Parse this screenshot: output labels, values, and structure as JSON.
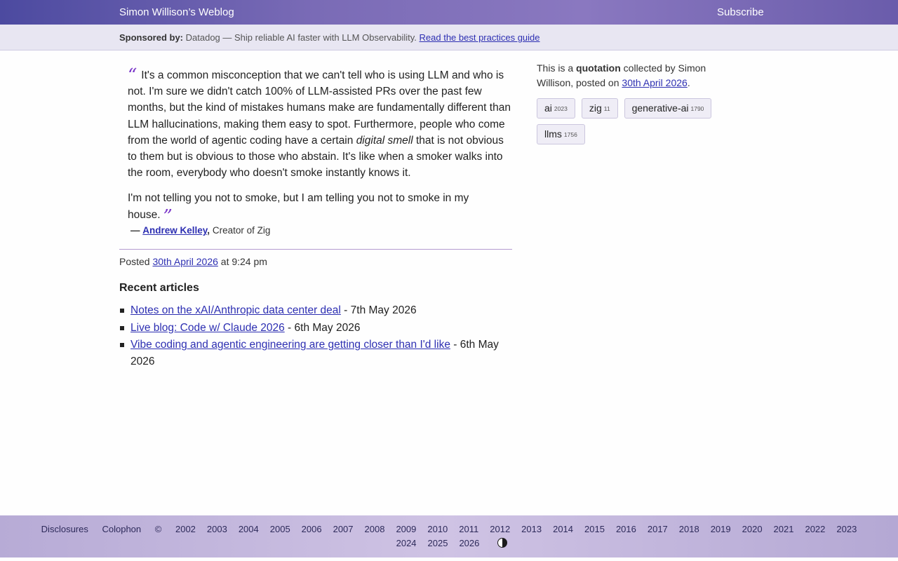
{
  "header": {
    "site_title": "Simon Willison’s Weblog",
    "subscribe_label": "Subscribe"
  },
  "sponsor": {
    "label": "Sponsored by:",
    "text": "Datadog — Ship reliable AI faster with LLM Observability.",
    "link_text": "Read the best practices guide"
  },
  "quote": {
    "p1_before": "It's a common misconception that we can't tell who is using LLM and who is not. I'm sure we didn't catch 100% of LLM-assisted PRs over the past few months, but the kind of mistakes humans make are fundamentally different than LLM hallucinations, making them easy to spot. Furthermore, people who come from the world of agentic coding have a certain ",
    "p1_em": "digital smell",
    "p1_after": " that is not obvious to them but is obvious to those who abstain. It's like when a smoker walks into the room, everybody who doesn't smoke instantly knows it.",
    "p2": "I'm not telling you not to smoke, but I am telling you not to smoke in my house.",
    "open_mark": "“",
    "close_mark": "”"
  },
  "citation": {
    "dash": "—",
    "author": "Andrew Kelley",
    "comma": ",",
    "role": "Creator of Zig"
  },
  "posted": {
    "prefix": "Posted",
    "date": "30th April 2026",
    "time": "at 9:24 pm"
  },
  "recent": {
    "title": "Recent articles",
    "items": [
      {
        "title": "Notes on the xAI/Anthropic data center deal",
        "date": "- 7th May 2026"
      },
      {
        "title": "Live blog: Code w/ Claude 2026",
        "date": "- 6th May 2026"
      },
      {
        "title": "Vibe coding and agentic engineering are getting closer than I'd like",
        "date": "- 6th May 2026"
      }
    ]
  },
  "sidebar": {
    "info_prefix": "This is a",
    "info_bold": "quotation",
    "info_mid": "collected by Simon Willison, posted on",
    "info_date": "30th April 2026",
    "info_end": ".",
    "tags": [
      {
        "name": "ai",
        "count": "2023"
      },
      {
        "name": "zig",
        "count": "11"
      },
      {
        "name": "generative-ai",
        "count": "1790"
      },
      {
        "name": "llms",
        "count": "1756"
      }
    ]
  },
  "footer": {
    "disclosures": "Disclosures",
    "colophon": "Colophon",
    "copyright": "©",
    "years_line1": [
      "2002",
      "2003",
      "2004",
      "2005",
      "2006",
      "2007",
      "2008",
      "2009",
      "2010",
      "2011",
      "2012",
      "2013",
      "2014",
      "2015",
      "2016",
      "2017",
      "2018",
      "2019",
      "2020",
      "2021",
      "2022",
      "2023"
    ],
    "years_line2": [
      "2024",
      "2025",
      "2026"
    ],
    "contrast_icon": "contrast-icon"
  }
}
